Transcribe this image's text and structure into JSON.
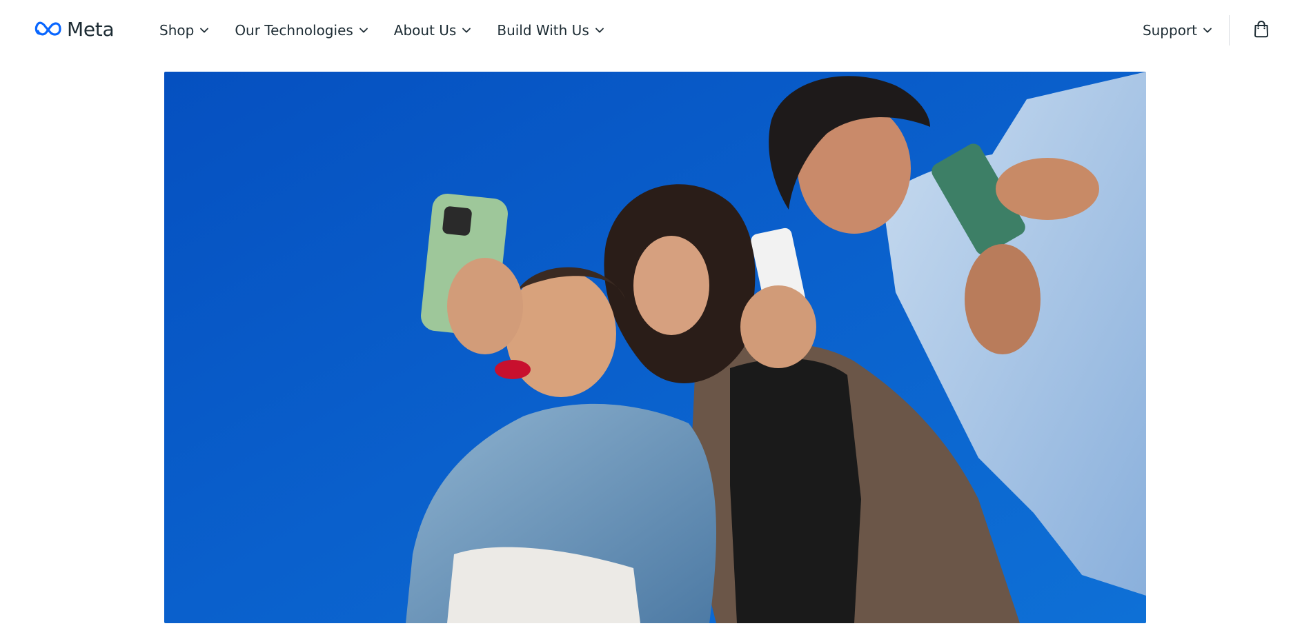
{
  "header": {
    "logo": {
      "text": "Meta",
      "icon": "meta-infinity-icon",
      "color": "#0866ff"
    },
    "nav": [
      {
        "label": "Shop",
        "icon": "chevron-down-icon"
      },
      {
        "label": "Our Technologies",
        "icon": "chevron-down-icon"
      },
      {
        "label": "About Us",
        "icon": "chevron-down-icon"
      },
      {
        "label": "Build With Us",
        "icon": "chevron-down-icon"
      }
    ],
    "support": {
      "label": "Support",
      "icon": "chevron-down-icon"
    },
    "cart": {
      "icon": "shopping-bag-icon"
    }
  },
  "hero": {
    "image": "three-people-smiling-at-phones-against-blue-sky",
    "sky_color": "#0a5ac4"
  }
}
